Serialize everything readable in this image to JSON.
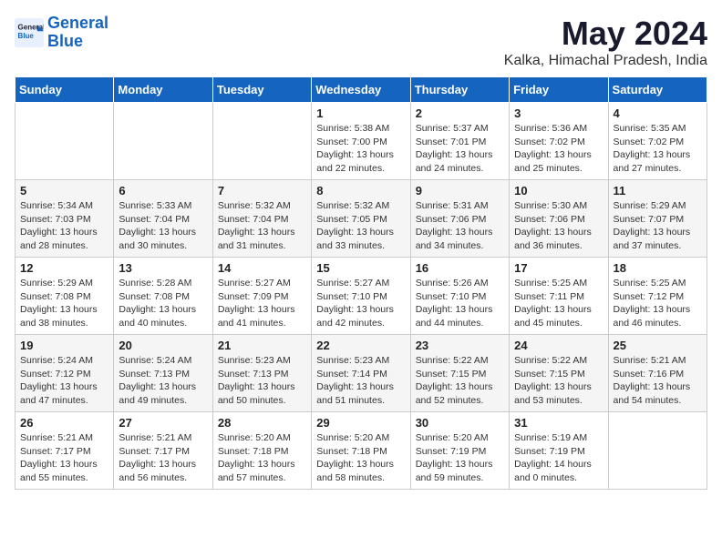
{
  "logo": {
    "line1": "General",
    "line2": "Blue"
  },
  "title": "May 2024",
  "subtitle": "Kalka, Himachal Pradesh, India",
  "weekdays": [
    "Sunday",
    "Monday",
    "Tuesday",
    "Wednesday",
    "Thursday",
    "Friday",
    "Saturday"
  ],
  "weeks": [
    [
      {
        "day": "",
        "info": ""
      },
      {
        "day": "",
        "info": ""
      },
      {
        "day": "",
        "info": ""
      },
      {
        "day": "1",
        "info": "Sunrise: 5:38 AM\nSunset: 7:00 PM\nDaylight: 13 hours\nand 22 minutes."
      },
      {
        "day": "2",
        "info": "Sunrise: 5:37 AM\nSunset: 7:01 PM\nDaylight: 13 hours\nand 24 minutes."
      },
      {
        "day": "3",
        "info": "Sunrise: 5:36 AM\nSunset: 7:02 PM\nDaylight: 13 hours\nand 25 minutes."
      },
      {
        "day": "4",
        "info": "Sunrise: 5:35 AM\nSunset: 7:02 PM\nDaylight: 13 hours\nand 27 minutes."
      }
    ],
    [
      {
        "day": "5",
        "info": "Sunrise: 5:34 AM\nSunset: 7:03 PM\nDaylight: 13 hours\nand 28 minutes."
      },
      {
        "day": "6",
        "info": "Sunrise: 5:33 AM\nSunset: 7:04 PM\nDaylight: 13 hours\nand 30 minutes."
      },
      {
        "day": "7",
        "info": "Sunrise: 5:32 AM\nSunset: 7:04 PM\nDaylight: 13 hours\nand 31 minutes."
      },
      {
        "day": "8",
        "info": "Sunrise: 5:32 AM\nSunset: 7:05 PM\nDaylight: 13 hours\nand 33 minutes."
      },
      {
        "day": "9",
        "info": "Sunrise: 5:31 AM\nSunset: 7:06 PM\nDaylight: 13 hours\nand 34 minutes."
      },
      {
        "day": "10",
        "info": "Sunrise: 5:30 AM\nSunset: 7:06 PM\nDaylight: 13 hours\nand 36 minutes."
      },
      {
        "day": "11",
        "info": "Sunrise: 5:29 AM\nSunset: 7:07 PM\nDaylight: 13 hours\nand 37 minutes."
      }
    ],
    [
      {
        "day": "12",
        "info": "Sunrise: 5:29 AM\nSunset: 7:08 PM\nDaylight: 13 hours\nand 38 minutes."
      },
      {
        "day": "13",
        "info": "Sunrise: 5:28 AM\nSunset: 7:08 PM\nDaylight: 13 hours\nand 40 minutes."
      },
      {
        "day": "14",
        "info": "Sunrise: 5:27 AM\nSunset: 7:09 PM\nDaylight: 13 hours\nand 41 minutes."
      },
      {
        "day": "15",
        "info": "Sunrise: 5:27 AM\nSunset: 7:10 PM\nDaylight: 13 hours\nand 42 minutes."
      },
      {
        "day": "16",
        "info": "Sunrise: 5:26 AM\nSunset: 7:10 PM\nDaylight: 13 hours\nand 44 minutes."
      },
      {
        "day": "17",
        "info": "Sunrise: 5:25 AM\nSunset: 7:11 PM\nDaylight: 13 hours\nand 45 minutes."
      },
      {
        "day": "18",
        "info": "Sunrise: 5:25 AM\nSunset: 7:12 PM\nDaylight: 13 hours\nand 46 minutes."
      }
    ],
    [
      {
        "day": "19",
        "info": "Sunrise: 5:24 AM\nSunset: 7:12 PM\nDaylight: 13 hours\nand 47 minutes."
      },
      {
        "day": "20",
        "info": "Sunrise: 5:24 AM\nSunset: 7:13 PM\nDaylight: 13 hours\nand 49 minutes."
      },
      {
        "day": "21",
        "info": "Sunrise: 5:23 AM\nSunset: 7:13 PM\nDaylight: 13 hours\nand 50 minutes."
      },
      {
        "day": "22",
        "info": "Sunrise: 5:23 AM\nSunset: 7:14 PM\nDaylight: 13 hours\nand 51 minutes."
      },
      {
        "day": "23",
        "info": "Sunrise: 5:22 AM\nSunset: 7:15 PM\nDaylight: 13 hours\nand 52 minutes."
      },
      {
        "day": "24",
        "info": "Sunrise: 5:22 AM\nSunset: 7:15 PM\nDaylight: 13 hours\nand 53 minutes."
      },
      {
        "day": "25",
        "info": "Sunrise: 5:21 AM\nSunset: 7:16 PM\nDaylight: 13 hours\nand 54 minutes."
      }
    ],
    [
      {
        "day": "26",
        "info": "Sunrise: 5:21 AM\nSunset: 7:17 PM\nDaylight: 13 hours\nand 55 minutes."
      },
      {
        "day": "27",
        "info": "Sunrise: 5:21 AM\nSunset: 7:17 PM\nDaylight: 13 hours\nand 56 minutes."
      },
      {
        "day": "28",
        "info": "Sunrise: 5:20 AM\nSunset: 7:18 PM\nDaylight: 13 hours\nand 57 minutes."
      },
      {
        "day": "29",
        "info": "Sunrise: 5:20 AM\nSunset: 7:18 PM\nDaylight: 13 hours\nand 58 minutes."
      },
      {
        "day": "30",
        "info": "Sunrise: 5:20 AM\nSunset: 7:19 PM\nDaylight: 13 hours\nand 59 minutes."
      },
      {
        "day": "31",
        "info": "Sunrise: 5:19 AM\nSunset: 7:19 PM\nDaylight: 14 hours\nand 0 minutes."
      },
      {
        "day": "",
        "info": ""
      }
    ]
  ]
}
